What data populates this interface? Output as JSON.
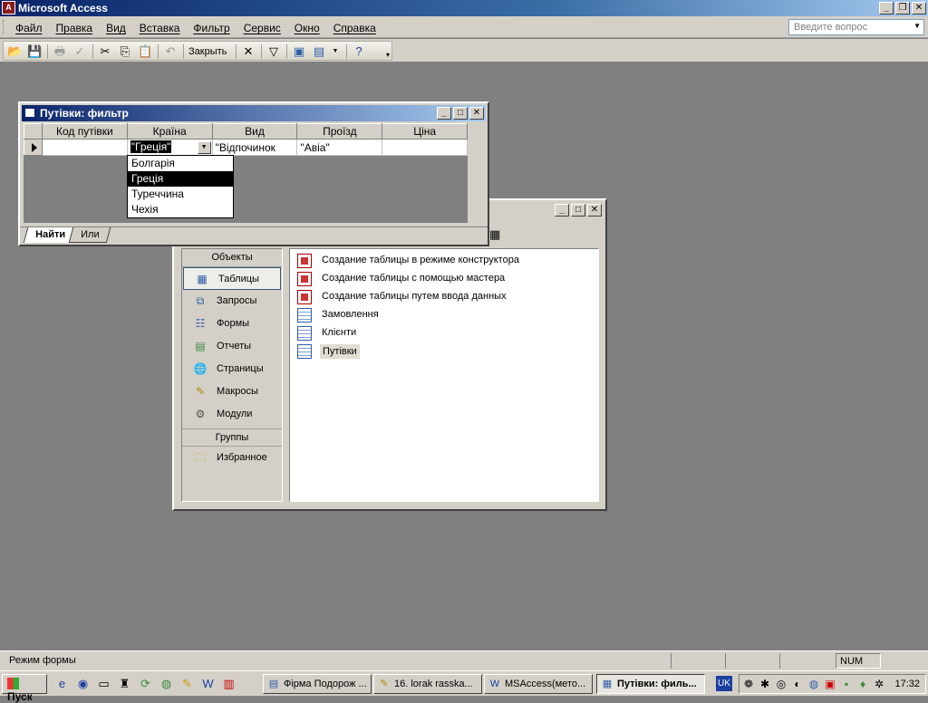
{
  "app": {
    "title": "Microsoft Access"
  },
  "menu": {
    "items": [
      "Файл",
      "Правка",
      "Вид",
      "Вставка",
      "Фильтр",
      "Сервис",
      "Окно",
      "Справка"
    ],
    "help_placeholder": "Введите вопрос"
  },
  "toolbar": {
    "close_label": "Закрыть"
  },
  "filter_window": {
    "title": "Путівки: фильтр",
    "columns": [
      "Код путівки",
      "Країна",
      "Вид",
      "Проїзд",
      "Ціна"
    ],
    "row": {
      "kod": "",
      "kraina": "\"Греція\"",
      "vyd": "\"Відпочинок",
      "proizd": "\"Авіа\"",
      "cina": ""
    },
    "dropdown": [
      "Болгарія",
      "Греція",
      "Туреччина",
      "Чехія"
    ],
    "dropdown_selected": "Греція",
    "tabs": [
      "Найти",
      "Или"
    ]
  },
  "db_window": {
    "objects_header": "Объекты",
    "objects": [
      {
        "label": "Таблицы",
        "icon": "tables-icon"
      },
      {
        "label": "Запросы",
        "icon": "queries-icon"
      },
      {
        "label": "Формы",
        "icon": "forms-icon"
      },
      {
        "label": "Отчеты",
        "icon": "reports-icon"
      },
      {
        "label": "Страницы",
        "icon": "pages-icon"
      },
      {
        "label": "Макросы",
        "icon": "macros-icon"
      },
      {
        "label": "Модули",
        "icon": "modules-icon"
      }
    ],
    "groups_header": "Группы",
    "favorites": "Избранное",
    "list": [
      "Создание таблицы в режиме конструктора",
      "Создание таблицы с помощью мастера",
      "Создание таблицы путем ввода данных",
      "Замовлення",
      "Клієнти",
      "Путівки"
    ]
  },
  "status": {
    "text": "Режим формы",
    "num": "NUM"
  },
  "taskbar": {
    "start": "Пуск",
    "tasks": [
      "Фірма Подорож ...",
      "16. lorak rasska...",
      "MSAccess(мето...",
      "Путівки: филь..."
    ],
    "language": "UK",
    "clock": "17:32"
  },
  "colors": {
    "title_active": "#0a246a",
    "desktop": "#808080",
    "face": "#d4d0c8"
  }
}
